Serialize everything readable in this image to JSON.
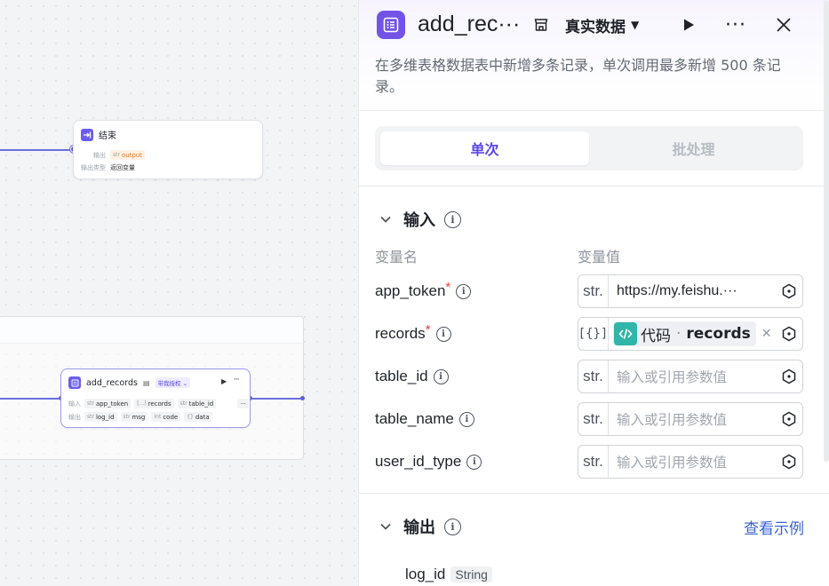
{
  "canvas": {
    "end_node": {
      "title": "结束",
      "output_label": "输出",
      "output_tag_type": "str",
      "output_tag": "output",
      "output_type_label": "输出类型",
      "output_type_value": "返回变量"
    },
    "records_node": {
      "title": "add_records",
      "badge": "带我授权",
      "input_label": "输入",
      "output_label": "输出",
      "inputs": [
        {
          "type": "str",
          "name": "app_token"
        },
        {
          "type": "[...]",
          "name": "records"
        },
        {
          "type": "str",
          "name": "table_id"
        }
      ],
      "outputs": [
        {
          "type": "str",
          "name": "log_id"
        },
        {
          "type": "str",
          "name": "msg"
        },
        {
          "type": "Int",
          "name": "code"
        },
        {
          "type": "{}",
          "name": "data"
        }
      ]
    }
  },
  "panel": {
    "title": "add_rec···",
    "data_mode": "真实数据",
    "description": "在多维表格数据表中新增多条记录，单次调用最多新增 500 条记录。",
    "tabs": [
      "单次",
      "批处理"
    ],
    "input_section": {
      "title": "输入",
      "col_name": "变量名",
      "col_value": "变量值",
      "rows": [
        {
          "name": "app_token",
          "required": true,
          "type": "str.",
          "value": "https://my.feishu.···",
          "placeholder": ""
        },
        {
          "name": "records",
          "required": true,
          "type": "[{}]",
          "ref_source": "代码",
          "ref_var": "records"
        },
        {
          "name": "table_id",
          "required": false,
          "type": "str.",
          "value": "",
          "placeholder": "输入或引用参数值"
        },
        {
          "name": "table_name",
          "required": false,
          "type": "str.",
          "value": "",
          "placeholder": "输入或引用参数值"
        },
        {
          "name": "user_id_type",
          "required": false,
          "type": "str.",
          "value": "",
          "placeholder": "输入或引用参数值"
        }
      ]
    },
    "output_section": {
      "title": "输出",
      "example_link": "查看示例",
      "items": [
        {
          "name": "log_id",
          "type": "String"
        }
      ]
    }
  },
  "colors": {
    "accent": "#5a48e6",
    "brand_icon": "#7353e6",
    "code_icon": "#2fb6a8",
    "link": "#3a63d9",
    "edge": "#6a6fe0"
  }
}
